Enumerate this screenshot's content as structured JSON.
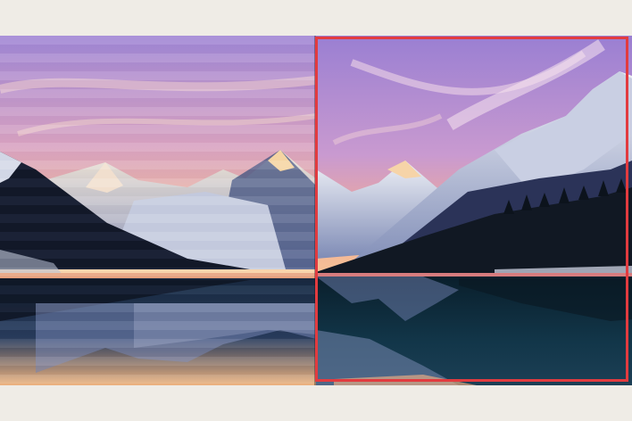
{
  "colors": {
    "page_background": "#efece6",
    "selection_frame": "#e23b3f",
    "sky_top": "#9a7fd2",
    "sky_horizon": "#f3b494",
    "water": "#0f2f3f"
  },
  "panels": [
    {
      "name": "left-variant",
      "effect": "horizontal-stripes",
      "selected": false
    },
    {
      "name": "right-variant",
      "effect": "none",
      "selected": true
    }
  ]
}
